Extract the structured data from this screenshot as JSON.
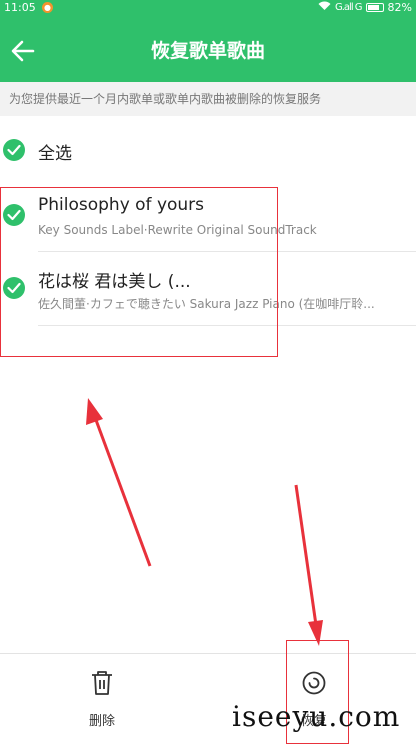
{
  "status_bar": {
    "time": "11:05",
    "notification_icon": "weibo-icon",
    "signal_text": "G.all G",
    "battery_percent": "82%",
    "battery_level": 0.82
  },
  "app_bar": {
    "back_icon": "arrow-left-icon",
    "title": "恢复歌单歌曲"
  },
  "notice": "为您提供最近一个月内歌单或歌单内歌曲被删除的恢复服务",
  "select_all": {
    "label": "全选",
    "checked": true
  },
  "songs": [
    {
      "title": "Philosophy of yours",
      "subtitle": "Key Sounds Label·Rewrite Original SoundTrack",
      "checked": true
    },
    {
      "title": "花は桜 君は美し (...",
      "subtitle": "佐久間董·カフェで聴きたい Sakura Jazz Piano (在咖啡厅聆...",
      "checked": true
    }
  ],
  "bottom_bar": {
    "delete_label": "删除",
    "restore_label": "恢复"
  },
  "watermark": "iseeyu.com",
  "colors": {
    "accent": "#2fc06b",
    "annotation_red": "#e8313b"
  }
}
